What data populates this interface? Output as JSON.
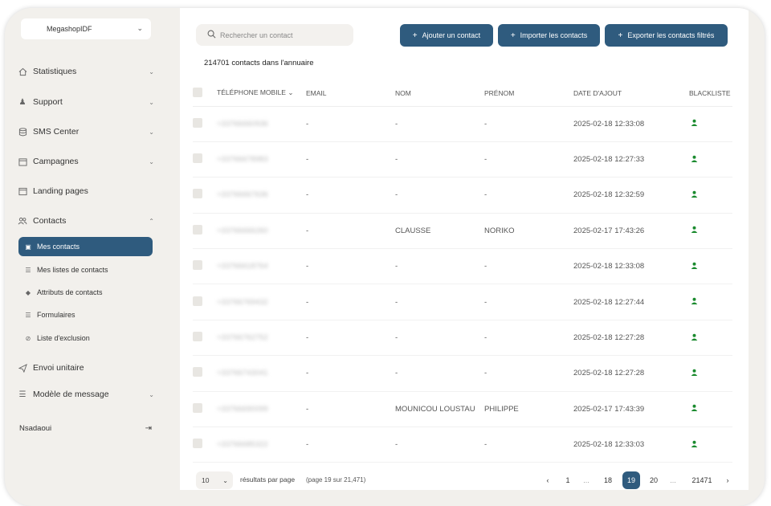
{
  "sidebar": {
    "org": "MegashopIDF",
    "items": [
      {
        "label": "Statistiques",
        "icon": "home-icon"
      },
      {
        "label": "Support",
        "icon": "chess-icon"
      },
      {
        "label": "SMS Center",
        "icon": "database-icon"
      },
      {
        "label": "Campagnes",
        "icon": "calendar-icon"
      },
      {
        "label": "Landing pages",
        "icon": "window-icon"
      },
      {
        "label": "Contacts",
        "icon": "users-icon"
      },
      {
        "label": "Envoi unitaire",
        "icon": "send-icon"
      },
      {
        "label": "Modèle de message",
        "icon": "template-icon"
      }
    ],
    "sub_items": [
      {
        "label": "Mes contacts",
        "icon": "contact-book-icon"
      },
      {
        "label": "Mes listes de contacts",
        "icon": "list-icon"
      },
      {
        "label": "Attributs de contacts",
        "icon": "tag-icon"
      },
      {
        "label": "Formulaires",
        "icon": "list-icon"
      },
      {
        "label": "Liste d'exclusion",
        "icon": "block-icon"
      }
    ],
    "user": "Nsadaoui"
  },
  "toolbar": {
    "search_placeholder": "Rechercher un contact",
    "add_label": "Ajouter un contact",
    "import_label": "Importer les contacts",
    "export_label": "Exporter les contacts filtrés"
  },
  "summary": "214701 contacts dans l'annuaire",
  "table": {
    "columns": [
      "TÉLÉPHONE MOBILE",
      "EMAIL",
      "NOM",
      "PRÉNOM",
      "DATE D'AJOUT",
      "BLACKLISTE"
    ],
    "rows": [
      {
        "phone": "+33766660936",
        "email": "-",
        "nom": "-",
        "prenom": "-",
        "date": "2025-02-18 12:33:08"
      },
      {
        "phone": "+33766678983",
        "email": "-",
        "nom": "-",
        "prenom": "-",
        "date": "2025-02-18 12:27:33"
      },
      {
        "phone": "+33766667636",
        "email": "-",
        "nom": "-",
        "prenom": "-",
        "date": "2025-02-18 12:32:59"
      },
      {
        "phone": "+33766666260",
        "email": "-",
        "nom": "CLAUSSE",
        "prenom": "NORIKO",
        "date": "2025-02-17 17:43:26"
      },
      {
        "phone": "+33766618764",
        "email": "-",
        "nom": "-",
        "prenom": "-",
        "date": "2025-02-18 12:33:08"
      },
      {
        "phone": "+33766769432",
        "email": "-",
        "nom": "-",
        "prenom": "-",
        "date": "2025-02-18 12:27:44"
      },
      {
        "phone": "+33766762752",
        "email": "-",
        "nom": "-",
        "prenom": "-",
        "date": "2025-02-18 12:27:28"
      },
      {
        "phone": "+33766743041",
        "email": "-",
        "nom": "-",
        "prenom": "-",
        "date": "2025-02-18 12:27:28"
      },
      {
        "phone": "+33766690099",
        "email": "-",
        "nom": "MOUNICOU LOUSTAU",
        "prenom": "PHILIPPE",
        "date": "2025-02-17 17:43:39"
      },
      {
        "phone": "+33766685322",
        "email": "-",
        "nom": "-",
        "prenom": "-",
        "date": "2025-02-18 12:33:03"
      }
    ]
  },
  "pagination": {
    "per_page": "10",
    "per_page_label": "résultats par page",
    "page_info": "(page 19 sur 21,471)",
    "pages": [
      "1",
      "...",
      "18",
      "19",
      "20",
      "...",
      "21471"
    ],
    "current": "19"
  }
}
